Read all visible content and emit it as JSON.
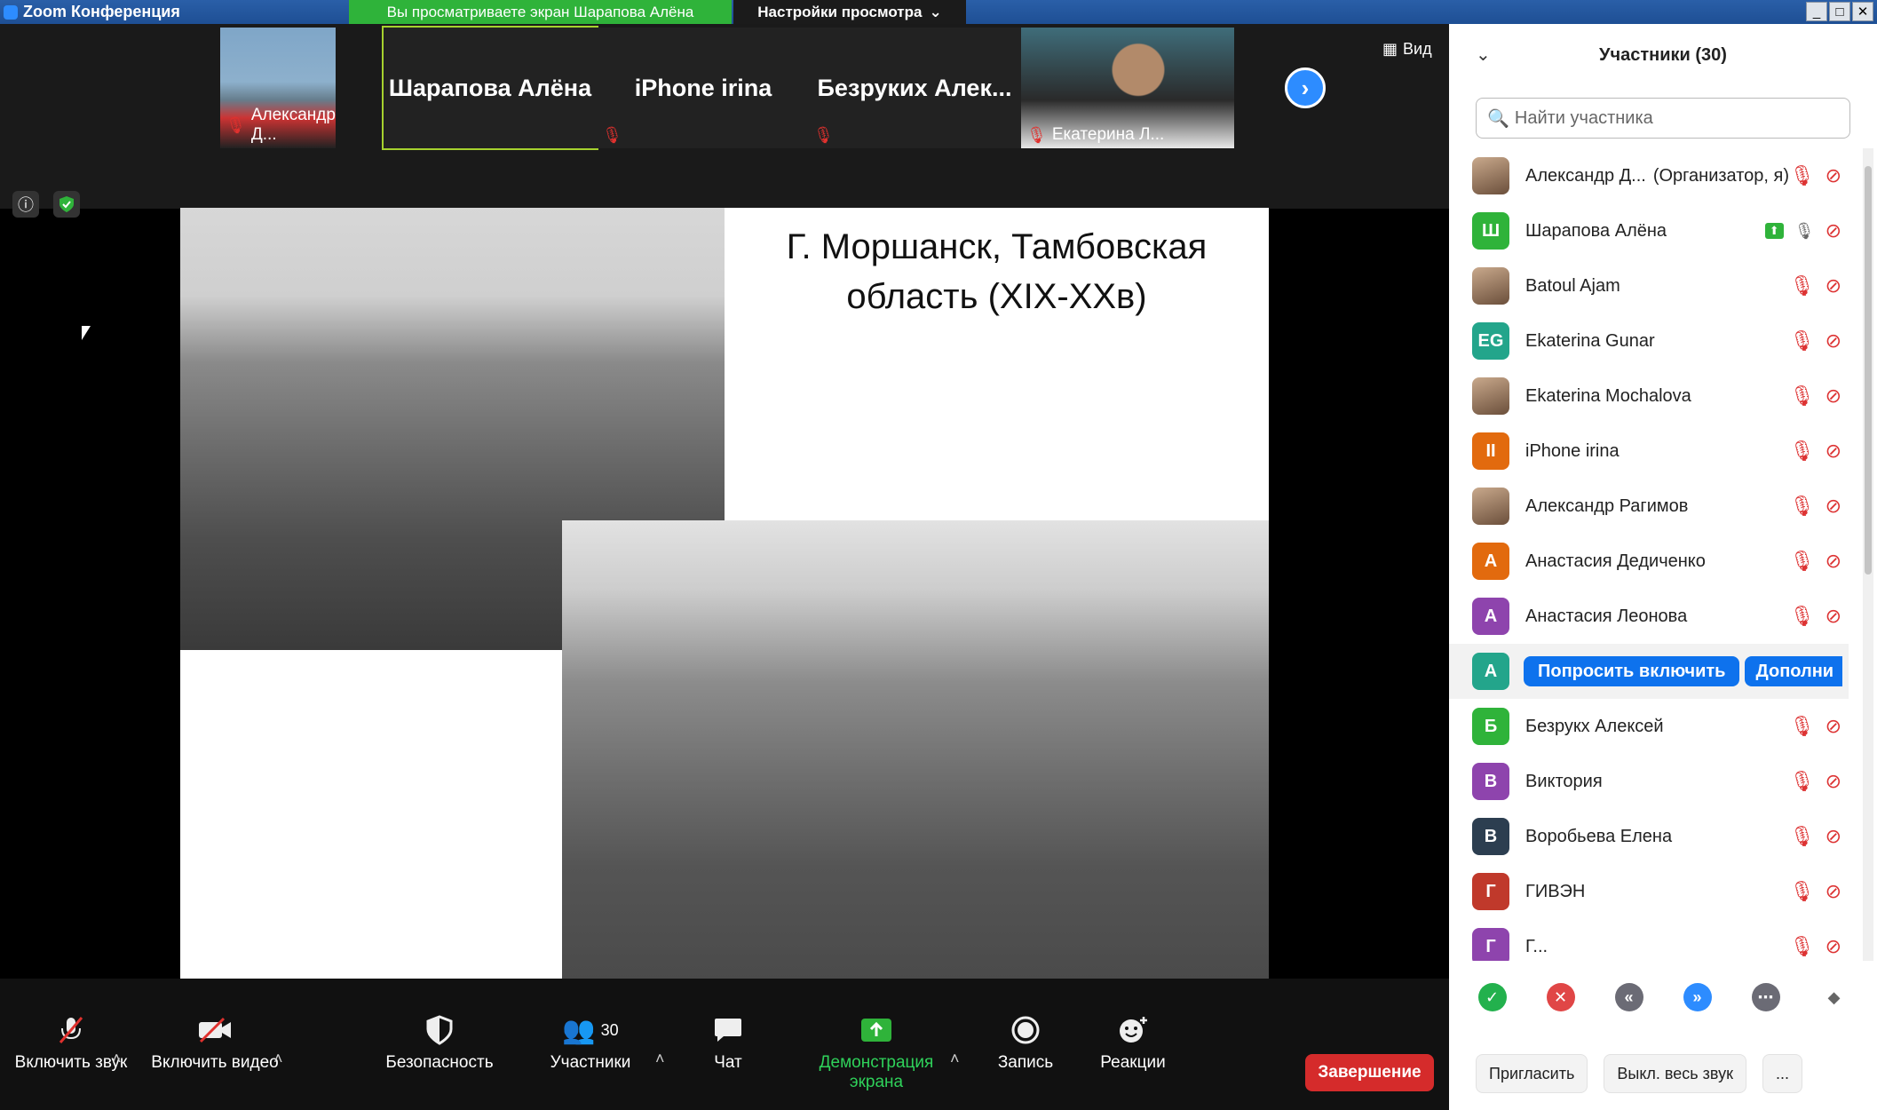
{
  "window": {
    "title": "Zoom Конференция"
  },
  "banner": {
    "share_text": "Вы просматриваете экран Шарапова Алёна",
    "view_settings": "Настройки просмотра"
  },
  "tiles": [
    {
      "label": "Александр Д...",
      "kind": "photo"
    },
    {
      "name": "Шарапова Алёна",
      "kind": "name",
      "active": true
    },
    {
      "name": "iPhone irina",
      "kind": "name"
    },
    {
      "name": "Безруких  Алек...",
      "kind": "name"
    },
    {
      "label": "Екатерина Л...",
      "kind": "photo"
    }
  ],
  "view_button": "Вид",
  "slide": {
    "title": "Г. Моршанск, Тамбовская область (XIX-XXв)"
  },
  "toolbar": {
    "unmute": "Включить звук",
    "video": "Включить видео",
    "security": "Безопасность",
    "participants": "Участники",
    "participants_count": "30",
    "chat": "Чат",
    "share": "Демонстрация экрана",
    "record": "Запись",
    "reactions": "Реакции",
    "end": "Завершение"
  },
  "panel": {
    "title": "Участники (30)",
    "search_placeholder": "Найти участника",
    "participants": [
      {
        "name": "Александр Д...",
        "role": "(Организатор, я)",
        "avatar": "photo"
      },
      {
        "name": "Шарапова Алёна",
        "avatar": "Ш",
        "color": "#2fb33a",
        "sharing": true
      },
      {
        "name": "Batoul Ajam",
        "avatar": "photo"
      },
      {
        "name": "Ekaterina Gunar",
        "avatar": "EG",
        "color": "#23a58b"
      },
      {
        "name": "Ekaterina Mochalova",
        "avatar": "photo"
      },
      {
        "name": "iPhone irina",
        "avatar": "II",
        "color": "#e26a0e"
      },
      {
        "name": "Александр Рагимов",
        "avatar": "photo"
      },
      {
        "name": "Анастасия Дедиченко",
        "avatar": "А",
        "color": "#e26a0e"
      },
      {
        "name": "Анастасия Леонова",
        "avatar": "А",
        "color": "#8e44ad"
      },
      {
        "name": "",
        "avatar": "А",
        "color": "#23a58b",
        "ask_button": "Попросить включить",
        "more_button": "Дополни"
      },
      {
        "name": "Безрукх Алексей",
        "avatar": "Б",
        "color": "#2fb33a"
      },
      {
        "name": "Виктория",
        "avatar": "В",
        "color": "#8e44ad"
      },
      {
        "name": "Воробьева Елена",
        "avatar": "В",
        "color": "#2c3e50"
      },
      {
        "name": "ГИВЭН",
        "avatar": "Г",
        "color": "#c0392b"
      },
      {
        "name": "Г...",
        "avatar": "Г",
        "color": "#8e44ad"
      }
    ],
    "invite": "Пригласить",
    "mute_all": "Выкл. весь звук",
    "more": "..."
  }
}
